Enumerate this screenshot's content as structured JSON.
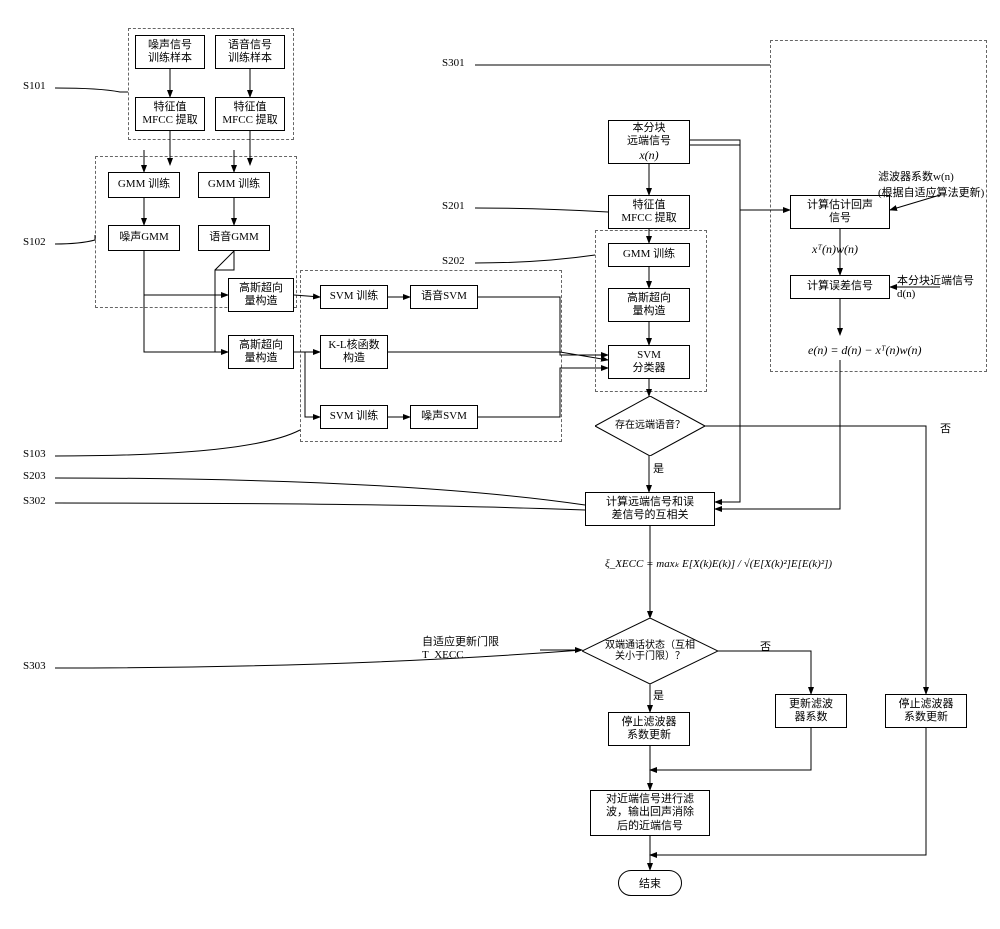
{
  "stage_labels": {
    "s101": "S101",
    "s102": "S102",
    "s103": "S103",
    "s201": "S201",
    "s202": "S202",
    "s203": "S203",
    "s301": "S301",
    "s302": "S302",
    "s303": "S303"
  },
  "top_blocks": {
    "noise_train": "噪声信号\n训练样本",
    "speech_train": "语音信号\n训练样本",
    "noise_mfcc": "特征值\nMFCC 提取",
    "speech_mfcc": "特征值\nMFCC 提取",
    "noise_gmm_train": "GMM 训练",
    "speech_gmm_train": "GMM 训练",
    "noise_gmm": "噪声GMM",
    "speech_gmm": "语音GMM",
    "gsv1": "高斯超向\n量构造",
    "gsv2": "高斯超向\n量构造",
    "svm_train_1": "SVM 训练",
    "svm_train_2": "SVM 训练",
    "speech_svm": "语音SVM",
    "noise_svm": "噪声SVM",
    "kl_kernel": "K-L核函数\n构造"
  },
  "right_blocks": {
    "far_block": "本分块\n远端信号",
    "far_sig": "x(n)",
    "mfcc": "特征值\nMFCC 提取",
    "gmm_train": "GMM 训练",
    "gsv": "高斯超向\n量构造",
    "svm_classifier": "SVM\n分类器",
    "est_echo": "计算估计回声\n信号",
    "est_echo_formula": "xᵀ(n)w(n)",
    "err_sig": "计算误差信号",
    "filter_coef": "滤波器系数w(n)\n(根据自适应算法更新)",
    "near_block": "本分块近端信号\nd(n)",
    "err_formula": "e(n) = d(n) − xᵀ(n)w(n)",
    "cross_corr": "计算远端信号和误\n差信号的互相关",
    "xecc_formula": "ξ_XECC = maxₖ  E[X(k)E(k)] / √(E[X(k)²]E[E(k)²])",
    "adaptive_thresh": "自适应更新门限\nT_XECC",
    "stop_update": "停止滤波器\n系数更新",
    "update_coef": "更新滤波\n器系数",
    "stop_update2": "停止滤波器\n系数更新",
    "filter_out": "对近端信号进行滤\n波，输出回声消除\n后的近端信号",
    "end": "结束"
  },
  "decisions": {
    "far_speech_q": "存在远端语音？",
    "yes": "是",
    "no": "否",
    "double_talk": "双端通话状态（互相\n关小于门限）？"
  }
}
